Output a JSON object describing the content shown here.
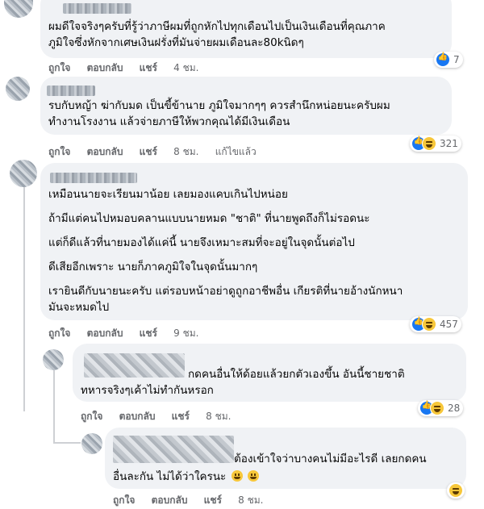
{
  "comments": [
    {
      "lines": [
        "ผมดีใจจริงๆครับที่รู้ว่าภาษีผมที่ถูกหักไปทุกเดือนไปเป็นเงินเดือนที่คุณภาค",
        "ภูมิใจซึ่งหักจากเศษเงินฝรั่งที่มันจ่ายผมเดือนละ80kนิดๆ"
      ],
      "actions": {
        "like": "ถูกใจ",
        "reply": "ตอบกลับ",
        "share": "แชร์",
        "time": "4 ชม."
      },
      "reactions": {
        "icons": [
          "like-icon"
        ],
        "count": "7"
      }
    },
    {
      "lines": [
        "รบกับหญ้า ฆ่ากับมด เป็นขี้ข้านาย ภูมิใจมากๆๆ ควรสำนึกหน่อยนะครับผม",
        "ทำงานโรงงาน แล้วจ่ายภาษีให้พวกคุณได้มีเงินเดือน"
      ],
      "actions": {
        "like": "ถูกใจ",
        "reply": "ตอบกลับ",
        "share": "แชร์",
        "time": "8 ชม.",
        "edited": "แก้ไขแล้ว"
      },
      "reactions": {
        "icons": [
          "like-icon",
          "haha-icon"
        ],
        "count": "321"
      }
    },
    {
      "lines": [
        "เหมือนนายจะเรียนมาน้อย เลยมองแคบเกินไปหน่อย",
        "ถ้ามีแต่คนไปหมอบคลานแบบนายหมด \"ชาติ\" ที่นายพูดถึงก็ไม่รอดนะ",
        "แต่ก็ดีแล้วที่นายมองได้แค่นี้ นายจึงเหมาะสมที่จะอยู่ในจุดนั้นต่อไป",
        "ดีเสียอีกเพราะ นายก็ภาคภูมิใจในจุดนั้นมากๆ",
        "เรายินดีกับนายนะครับ แต่รอบหน้าอย่าดูถูกอาชีพอื่น เกียรติที่นายอ้างนักหนา",
        "มันจะหมดไป"
      ],
      "actions": {
        "like": "ถูกใจ",
        "reply": "ตอบกลับ",
        "share": "แชร์",
        "time": "9 ชม."
      },
      "reactions": {
        "icons": [
          "like-icon",
          "haha-icon"
        ],
        "count": "457"
      }
    },
    {
      "lines": [
        "กดคนอื่นให้ด้อยแล้วยกตัวเองขึ้น อันนี้ชายชาติ",
        "ทหารจริงๆเค้าไม่ทำกันหรอก"
      ],
      "actions": {
        "like": "ถูกใจ",
        "reply": "ตอบกลับ",
        "share": "แชร์",
        "time": "8 ชม."
      },
      "reactions": {
        "icons": [
          "like-icon",
          "haha-icon"
        ],
        "count": "28"
      }
    },
    {
      "lines": [
        "ต้องเข้าใจว่าบางคนไม่มีอะไรดี เลยกดคน",
        "อื่นละกัน ไม่ได้ว่าใครนะ"
      ],
      "actions": {
        "like": "ถูกใจ",
        "reply": "ตอบกลับ",
        "share": "แชร์",
        "time": "8 ชม."
      },
      "reactions": {
        "icons": [
          "haha-icon"
        ],
        "count": ""
      }
    }
  ],
  "colors": {
    "bubble": "#f0f2f5",
    "meta": "#65676b",
    "like": "#1877f2",
    "haha": "#f7c73a"
  }
}
